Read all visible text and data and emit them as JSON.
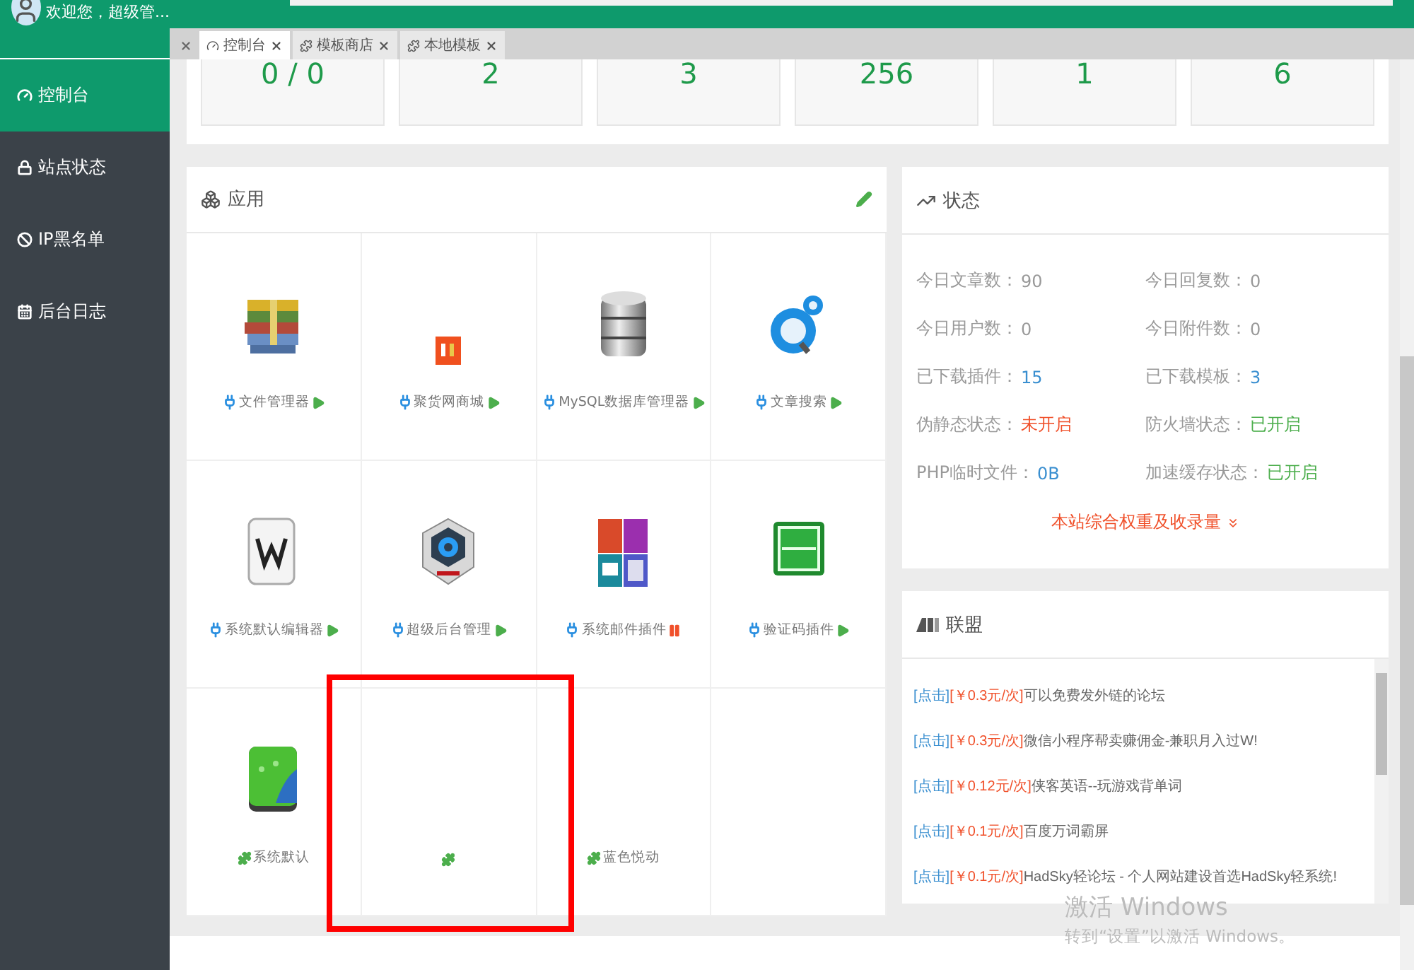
{
  "sidebar": {
    "welcome": "欢迎您，超级管...",
    "items": [
      {
        "label": "控制台",
        "selected": true
      },
      {
        "label": "站点状态",
        "selected": false
      },
      {
        "label": "IP黑名单",
        "selected": false
      },
      {
        "label": "后台日志",
        "selected": false
      }
    ]
  },
  "tabs": [
    {
      "label": "控制台",
      "selected": true
    },
    {
      "label": "模板商店",
      "selected": false
    },
    {
      "label": "本地模板",
      "selected": false
    }
  ],
  "stats": [
    "0 / 0",
    "2",
    "3",
    "256",
    "1",
    "6"
  ],
  "apps": {
    "title": "应用",
    "items": [
      {
        "name": "文件管理器",
        "kind": "plugin",
        "enabled": true
      },
      {
        "name": "聚货网商城",
        "kind": "plugin",
        "enabled": true
      },
      {
        "name": "MySQL数据库管理器",
        "kind": "plugin",
        "enabled": true
      },
      {
        "name": "文章搜索",
        "kind": "plugin",
        "enabled": true
      },
      {
        "name": "系统默认编辑器",
        "kind": "plugin",
        "enabled": true
      },
      {
        "name": "超级后台管理",
        "kind": "plugin",
        "enabled": true
      },
      {
        "name": "系统邮件插件",
        "kind": "plugin",
        "enabled": false
      },
      {
        "name": "验证码插件",
        "kind": "plugin",
        "enabled": true
      },
      {
        "name": "系统默认",
        "kind": "template"
      },
      {
        "kind": "template"
      },
      {
        "name": "蓝色悦动",
        "kind": "template"
      }
    ]
  },
  "status": {
    "title": "状态",
    "rows": [
      {
        "label": "今日文章数：",
        "value": "90"
      },
      {
        "label": "今日回复数：",
        "value": "0"
      },
      {
        "label": "今日用户数：",
        "value": "0"
      },
      {
        "label": "今日附件数：",
        "value": "0"
      },
      {
        "label": "已下载插件：",
        "value": "15",
        "color": "#3a8fd0"
      },
      {
        "label": "已下载模板：",
        "value": "3",
        "color": "#3a8fd0"
      },
      {
        "label": "伪静态状态：",
        "value": "未开启",
        "color": "#f0502a"
      },
      {
        "label": "防火墙状态：",
        "value": "已开启",
        "color": "#4cae4c"
      },
      {
        "label": "PHP临时文件：",
        "value": "0B",
        "color": "#3a8fd0"
      },
      {
        "label": "加速缓存状态：",
        "value": "已开启",
        "color": "#4cae4c"
      }
    ],
    "more_link": "本站综合权重及收录量"
  },
  "league": {
    "title": "联盟",
    "items": [
      {
        "tag": "[点击]",
        "price": "[￥0.3元/次]",
        "text": "可以免费发外链的论坛"
      },
      {
        "tag": "[点击]",
        "price": "[￥0.3元/次]",
        "text": "微信小程序帮卖赚佣金-兼职月入过W!"
      },
      {
        "tag": "[点击]",
        "price": "[￥0.12元/次]",
        "text": "侠客英语--玩游戏背单词"
      },
      {
        "tag": "[点击]",
        "price": "[￥0.1元/次]",
        "text": "百度万词霸屏"
      },
      {
        "tag": "[点击]",
        "price": "[￥0.1元/次]",
        "text": "HadSky轻论坛 - 个人网站建设首选HadSky轻系统!"
      }
    ]
  },
  "windows_notice": {
    "title": "激活 Windows",
    "text": "转到“设置”以激活 Windows。"
  }
}
